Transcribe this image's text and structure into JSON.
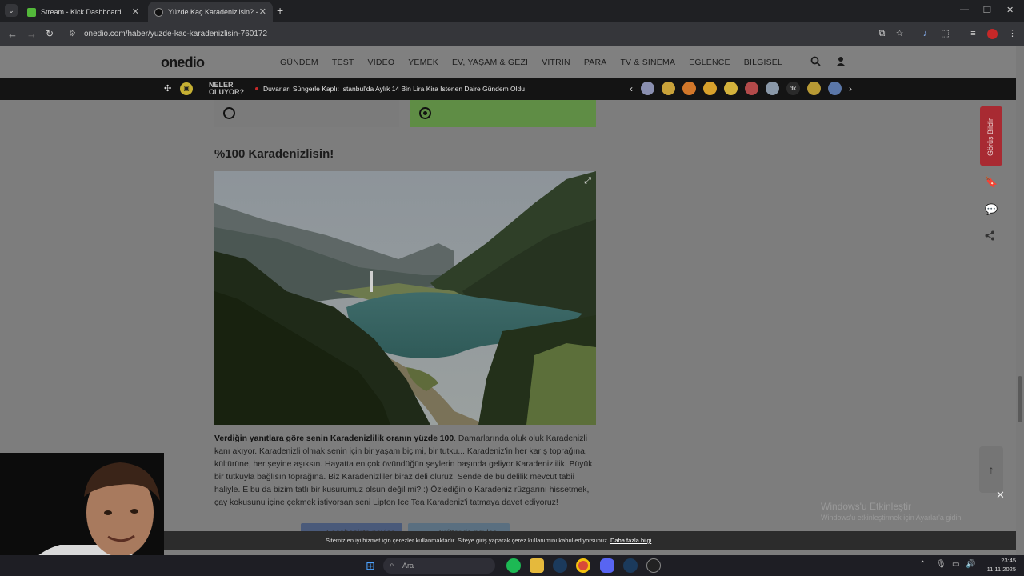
{
  "browser": {
    "tabs": [
      {
        "title": "Stream - Kick Dashboard",
        "active": false
      },
      {
        "title": "Yüzde Kaç Karadenizlisin? - Onedio",
        "active": true
      }
    ],
    "new_tab": "+",
    "url": "onedio.com/haber/yuzde-kac-karadenizlisin-760172"
  },
  "site": {
    "logo": "onedio",
    "nav": [
      "GÜNDEM",
      "TEST",
      "VİDEO",
      "YEMEK",
      "EV, YAŞAM & GEZİ",
      "VİTRİN",
      "PARA",
      "TV & SİNEMA",
      "EĞLENCE",
      "BİLGİSEL"
    ],
    "newsbar_label_1": "NELER",
    "newsbar_label_2": "OLUYOR?",
    "headline": "Duvarları Süngerle Kaplı: İstanbul'da Aylık 14 Bin Lira Kira İstenen Daire Gündem Oldu",
    "emoji_colors": [
      "#8a8fb0",
      "#c9a23a",
      "#d2772a",
      "#d8a12c",
      "#d4b23c",
      "#b34a4a",
      "#8a98a8",
      "#2a2a2a",
      "#b89a34",
      "#5b77a8"
    ],
    "emoji_labels": [
      "",
      "",
      "",
      "",
      "",
      "",
      "",
      "dk",
      "",
      ""
    ]
  },
  "article": {
    "result_title": "%100 Karadenizlisin!",
    "result_bold": "Verdiğin yanıtlara göre senin Karadenizlilik oranın yüzde 100",
    "result_body": ". Damarlarında oluk oluk Karadenizli kanı akıyor. Karadenizli olmak senin için bir yaşam biçimi, bir tutku... Karadeniz'in her karış toprağına, kültürüne, her şeyine aşıksın. Hayatta en çok övündüğün şeylerin başında geliyor Karadenizlilik. Büyük bir tutkuyla bağlısın toprağına. Biz Karadenizliler biraz deli oluruz. Sende de bu delilik mevcut tabii haliyle. E bu da bizim tatlı bir kusurumuz olsun değil mi? :) Özlediğin o Karadeniz rüzgarını hissetmek, çay kokusunu içine çekmek istiyorsan seni Lipton Ice Tea Karadeniz'i tatmaya davet ediyoruz!",
    "share_facebook": "Facebook'ta paylaş",
    "share_twitter": "Twitter'da paylaş"
  },
  "sidebar": {
    "feedback": "Görüş Bildir"
  },
  "cookie": {
    "text": "Sitemiz en iyi hizmet için çerezler kullanmaktadır. Siteye giriş yaparak çerez kullanımını kabul ediyorsunuz.",
    "link": "Daha fazla bilgi"
  },
  "windows": {
    "activate_title": "Windows'u Etkinleştir",
    "activate_sub": "Windows'u etkinleştirmek için Ayarlar'a gidin.",
    "search_placeholder": "Ara",
    "time": "23:45",
    "date": "11.11.2025"
  },
  "colors": {
    "selected_answer": "#5f8d45",
    "feedback_tab": "#a82a32"
  }
}
